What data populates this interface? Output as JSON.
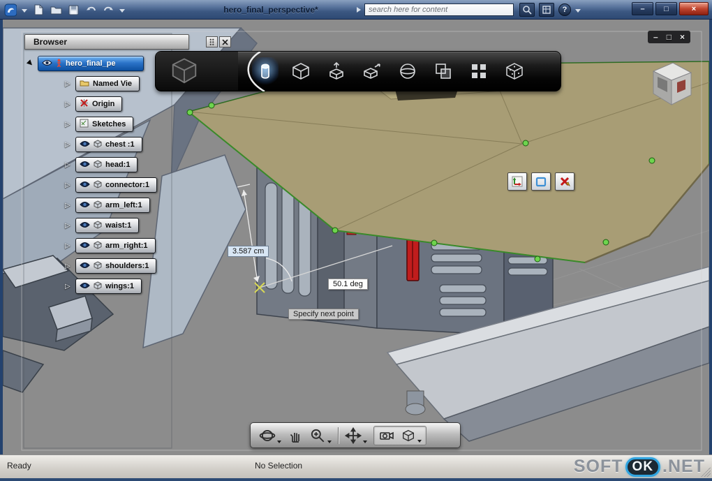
{
  "titlebar": {
    "title": "hero_final_perspective*",
    "search_placeholder": "search here for content",
    "help_glyph": "?",
    "window_buttons": {
      "minimize": "–",
      "maximize": "□",
      "close": "×"
    }
  },
  "inner_window": {
    "minimize": "–",
    "restore": "□",
    "close": "×"
  },
  "browser": {
    "title": "Browser",
    "root_label": "hero_final_pe",
    "items": [
      "Named Vie",
      "Origin",
      "Sketches",
      "chest :1",
      "head:1",
      "connector:1",
      "arm_left:1",
      "waist:1",
      "arm_right:1",
      "shoulders:1",
      "wings:1"
    ]
  },
  "viewport": {
    "length_dimension": "3.587 cm",
    "angle_dimension": "50.1 deg",
    "prompt_tooltip": "Specify next point"
  },
  "status": {
    "left": "Ready",
    "selection": "No Selection",
    "watermark": {
      "part1": "SOFT",
      "badge": "OK",
      "part2": ".NET"
    }
  },
  "colors": {
    "canopy_tan": "#a89d75",
    "edge_green": "#3a8a2a",
    "selection_blue": "#1f6fd0",
    "accent_red": "#c41f1f",
    "accent_orange": "#d9901f",
    "viewport_gray": "#8c8c8c"
  }
}
